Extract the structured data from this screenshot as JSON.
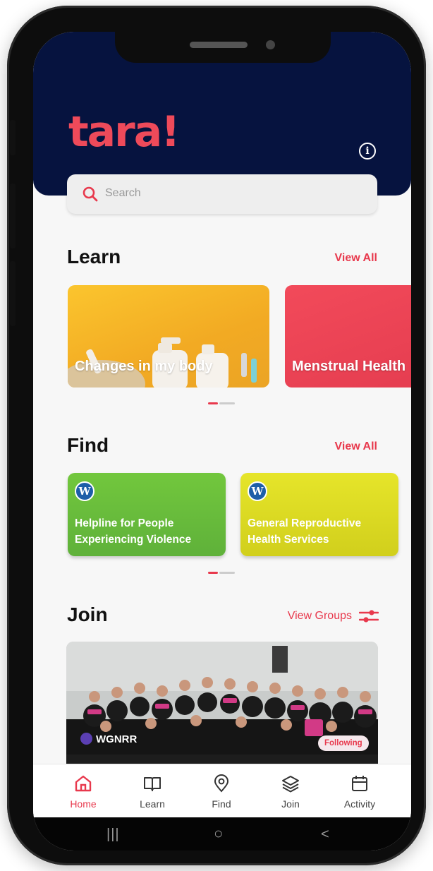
{
  "app": {
    "logo": "tara!"
  },
  "search": {
    "placeholder": "Search"
  },
  "learn": {
    "title": "Learn",
    "view_all": "View All",
    "cards": [
      {
        "label": "Changes in my body",
        "color": "#f6b62a"
      },
      {
        "label": "Menstrual Health",
        "color": "#ea4457"
      }
    ]
  },
  "find": {
    "title": "Find",
    "view_all": "View All",
    "cards": [
      {
        "icon": "wordpress-icon",
        "label": "Helpline for People Experiencing Violence",
        "color": "#6cbf3a"
      },
      {
        "icon": "wordpress-icon",
        "label": "General Reproductive Health Services",
        "color": "#d5d421"
      }
    ]
  },
  "join": {
    "title": "Join",
    "view_groups": "View Groups",
    "group": {
      "name": "WGNRR",
      "status": "Following"
    }
  },
  "tabbar": {
    "active": "Home",
    "tabs": [
      {
        "label": "Home",
        "icon": "home-icon"
      },
      {
        "label": "Learn",
        "icon": "book-icon"
      },
      {
        "label": "Find",
        "icon": "location-pin-icon"
      },
      {
        "label": "Join",
        "icon": "layers-icon"
      },
      {
        "label": "Activity",
        "icon": "calendar-icon"
      }
    ]
  },
  "system_nav": {
    "recents": "|||",
    "home": "○",
    "back": "<"
  },
  "colors": {
    "accent": "#e8394d",
    "header": "#06133f",
    "background": "#f7f7f7"
  }
}
